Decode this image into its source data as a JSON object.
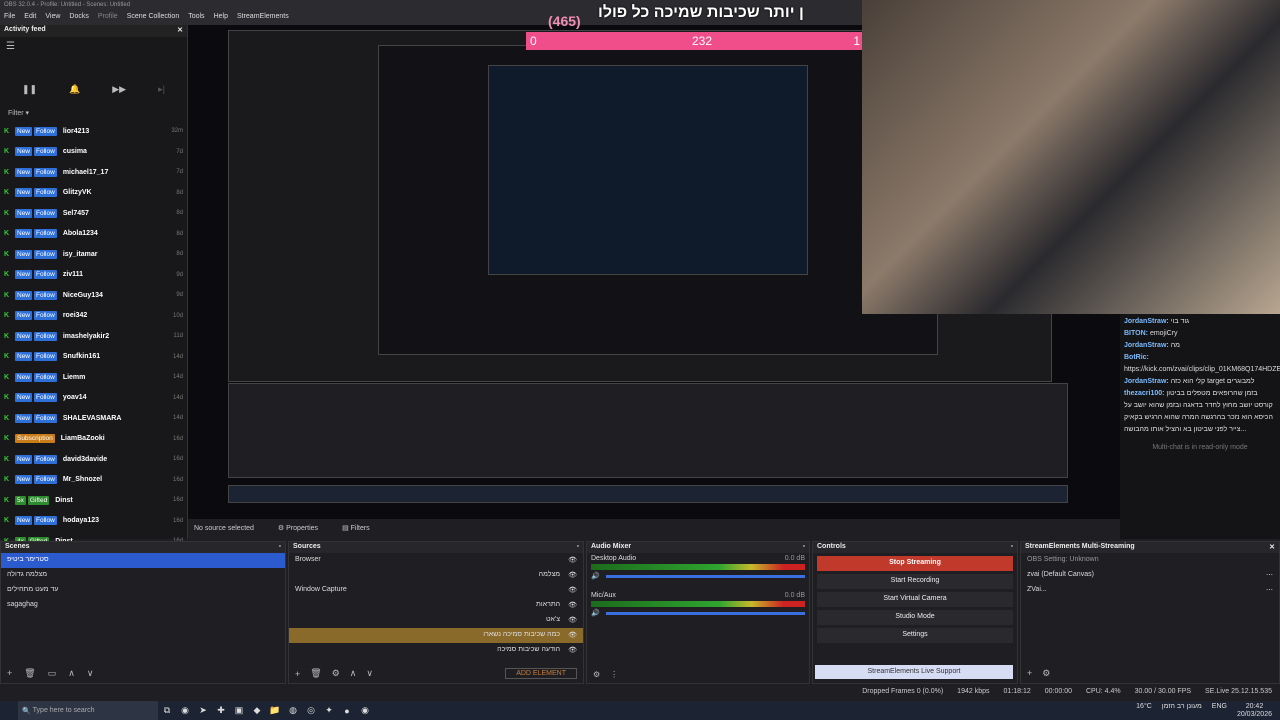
{
  "titlebar": "OBS 32.0.4 - Profile: Untitled - Scenes: Untitled",
  "menu": [
    "File",
    "Edit",
    "View",
    "Docks",
    "Profile",
    "Scene Collection",
    "Tools",
    "Help",
    "StreamElements"
  ],
  "feed": {
    "title": "Activity feed",
    "filter": "Filter",
    "items": [
      {
        "type": "New",
        "badge": "Follow",
        "name": "lior4213",
        "time": "32m"
      },
      {
        "type": "New",
        "badge": "Follow",
        "name": "cusima",
        "time": "7d"
      },
      {
        "type": "New",
        "badge": "Follow",
        "name": "michael17_17",
        "time": "7d"
      },
      {
        "type": "New",
        "badge": "Follow",
        "name": "GlitzyVK",
        "time": "8d"
      },
      {
        "type": "New",
        "badge": "Follow",
        "name": "Sel7457",
        "time": "8d"
      },
      {
        "type": "New",
        "badge": "Follow",
        "name": "Abola1234",
        "time": "8d"
      },
      {
        "type": "New",
        "badge": "Follow",
        "name": "isy_itamar",
        "time": "8d"
      },
      {
        "type": "New",
        "badge": "Follow",
        "name": "ziv111",
        "time": "9d"
      },
      {
        "type": "New",
        "badge": "Follow",
        "name": "NiceGuy134",
        "time": "9d"
      },
      {
        "type": "New",
        "badge": "Follow",
        "name": "roei342",
        "time": "10d"
      },
      {
        "type": "New",
        "badge": "Follow",
        "name": "imashelyakir2",
        "time": "11d"
      },
      {
        "type": "New",
        "badge": "Follow",
        "name": "Snufkin161",
        "time": "14d"
      },
      {
        "type": "New",
        "badge": "Follow",
        "name": "Liemm",
        "time": "14d"
      },
      {
        "type": "New",
        "badge": "Follow",
        "name": "yoav14",
        "time": "14d"
      },
      {
        "type": "New",
        "badge": "Follow",
        "name": "SHALEVASMARA",
        "time": "14d"
      },
      {
        "type": "",
        "badge": "Subscription",
        "name": "LiamBaZooki",
        "time": "16d"
      },
      {
        "type": "New",
        "badge": "Follow",
        "name": "david3davide",
        "time": "16d"
      },
      {
        "type": "New",
        "badge": "Follow",
        "name": "Mr_Shnozel",
        "time": "16d"
      },
      {
        "type": "5x",
        "badge": "Gifted",
        "name": "Dinst",
        "time": "16d"
      },
      {
        "type": "New",
        "badge": "Follow",
        "name": "hodaya123",
        "time": "16d"
      },
      {
        "type": "4x",
        "badge": "Gifted",
        "name": "Dinst",
        "time": "16d"
      }
    ]
  },
  "overlay": {
    "counter": "(465)",
    "heading": "ן יותר שכיבות שמיכה כל פולו",
    "bar_left": "0",
    "bar_mid": "232",
    "bar_right": "1"
  },
  "chat": {
    "lines": [
      {
        "user": "JordanStraw:",
        "text": "גוד בוי"
      },
      {
        "user": "BITON:",
        "text": "emojiCry"
      },
      {
        "user": "JordanStraw:",
        "text": "מה"
      },
      {
        "user": "BotRic:",
        "text": "https://kick.com/zvai/clips/clip_01KM68Q174HDZEEFBRME0B0J1C"
      },
      {
        "user": "JordanStraw:",
        "text": "קלי הוא כזה target למבוגרים"
      },
      {
        "user": "thezacri100:",
        "text": "בזמן שהרופאים מטפלים בביטון קורסט יושב מחוץ לחדר בדאגה ובזמן שהוא יושב על הכיסא הוא נזכר בהרגשה המרה שהוא הרגיש בקאיק צייר לפני שביטון בא והציל אותו מהבושה..."
      }
    ],
    "readonly": "Multi-chat is in read-only mode"
  },
  "statusrow": {
    "no_source": "No source selected",
    "properties": "Properties",
    "filters": "Filters"
  },
  "scenes": {
    "title": "Scenes",
    "items": [
      "סטרימר ביטיפ",
      "מצלמה גדולה",
      "עד מעט מתחילים",
      "sagaghag"
    ]
  },
  "sources": {
    "title": "Sources",
    "items": [
      "Browser",
      "מצלמה",
      "Window Capture",
      "התראות",
      "צ'אט",
      "כמה שכיבות סמיכה נשארו",
      "הודעה שכיבות סמיכה"
    ],
    "add_element": "ADD ELEMENT"
  },
  "mixer": {
    "title": "Audio Mixer",
    "channels": [
      {
        "name": "Desktop Audio",
        "db": "0.0 dB"
      },
      {
        "name": "Mic/Aux",
        "db": "0.0 dB"
      }
    ]
  },
  "controls": {
    "title": "Controls",
    "buttons": [
      "Stop Streaming",
      "Start Recording",
      "Start Virtual Camera",
      "Studio Mode",
      "Settings"
    ],
    "live_support": "StreamElements Live Support"
  },
  "multistream": {
    "title": "StreamElements Multi-Streaming",
    "rows": [
      "OBS Setting: Unknown",
      "zvai (Default Canvas)",
      "ZVai..."
    ]
  },
  "footer": {
    "dropped": "Dropped Frames 0 (0.0%)",
    "bitrate": "1942 kbps",
    "time": "01:18:12",
    "rec": "00:00:00",
    "cpu": "CPU: 4.4%",
    "fps": "30.00 / 30.00 FPS",
    "version": "SE.Live 25.12.15.535"
  },
  "taskbar": {
    "search": "Type here to search",
    "weather": "16°C",
    "weather_text": "מעונן רב הזמן",
    "lang": "ENG",
    "clock": "20:42",
    "date": "20/03/2026"
  }
}
